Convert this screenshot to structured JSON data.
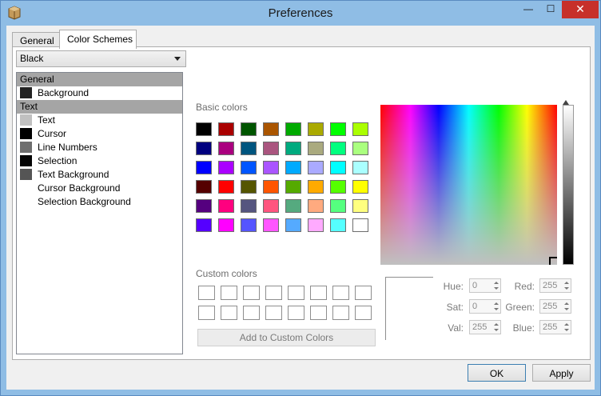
{
  "window": {
    "title": "Preferences",
    "close_glyph": "✕",
    "min_glyph": "—",
    "max_glyph": "☐"
  },
  "tabs": [
    {
      "label": "General",
      "active": false
    },
    {
      "label": "Color Schemes",
      "active": true
    }
  ],
  "scheme_select": {
    "value": "Black"
  },
  "tree": [
    {
      "type": "header",
      "label": "General"
    },
    {
      "type": "item",
      "label": "Background",
      "swatch": "#222222"
    },
    {
      "type": "header",
      "label": "Text"
    },
    {
      "type": "item",
      "label": "Text",
      "swatch": "#c0c0c0"
    },
    {
      "type": "item",
      "label": "Cursor",
      "swatch": "#000000"
    },
    {
      "type": "item",
      "label": "Line Numbers",
      "swatch": "#6e6e6e"
    },
    {
      "type": "item",
      "label": "Selection",
      "swatch": "#050505"
    },
    {
      "type": "item",
      "label": "Text Background",
      "swatch": "#555555"
    },
    {
      "type": "item",
      "label": "Cursor Background",
      "swatch": null
    },
    {
      "type": "item",
      "label": "Selection Background",
      "swatch": null
    }
  ],
  "color_dialog": {
    "basic_label": "Basic colors",
    "custom_label": "Custom colors",
    "add_button": "Add to Custom Colors",
    "basic_colors": [
      [
        "#000000",
        "#aa0000",
        "#005500",
        "#aa5500",
        "#00aa00",
        "#aaaa00",
        "#00ff00",
        "#aaff00"
      ],
      [
        "#00007f",
        "#aa007f",
        "#00557f",
        "#aa557f",
        "#00aa7f",
        "#aaaa7f",
        "#00ff7f",
        "#aaff7f"
      ],
      [
        "#0000ff",
        "#aa00ff",
        "#0055ff",
        "#aa55ff",
        "#00aaff",
        "#aaaaff",
        "#00ffff",
        "#aaffff"
      ],
      [
        "#550000",
        "#ff0000",
        "#555500",
        "#ff5500",
        "#55aa00",
        "#ffaa00",
        "#55ff00",
        "#ffff00"
      ],
      [
        "#55007f",
        "#ff007f",
        "#55557f",
        "#ff557f",
        "#55aa7f",
        "#ffaa7f",
        "#55ff7f",
        "#ffff7f"
      ],
      [
        "#5500ff",
        "#ff00ff",
        "#5555ff",
        "#ff55ff",
        "#55aaff",
        "#ffaaff",
        "#55ffff",
        "#ffffff"
      ]
    ],
    "custom_rows": 2,
    "custom_cols": 8,
    "fields": {
      "hue": {
        "label": "Hue:",
        "value": "0"
      },
      "sat": {
        "label": "Sat:",
        "value": "0"
      },
      "val": {
        "label": "Val:",
        "value": "255"
      },
      "red": {
        "label": "Red:",
        "value": "255"
      },
      "green": {
        "label": "Green:",
        "value": "255"
      },
      "blue": {
        "label": "Blue:",
        "value": "255"
      }
    }
  },
  "buttons": {
    "ok": "OK",
    "apply": "Apply"
  }
}
